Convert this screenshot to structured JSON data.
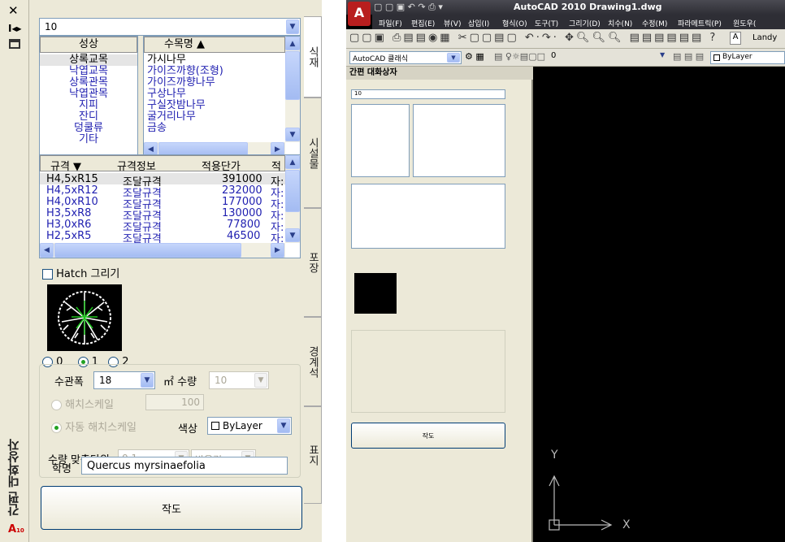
{
  "left": {
    "dropdown_top": "10",
    "list1": {
      "header": "성상",
      "items": [
        "상록교목",
        "낙엽교목",
        "상록관목",
        "낙엽관목",
        "지피",
        "잔디",
        "덩쿨류",
        "기타"
      ]
    },
    "list2": {
      "header": "수목명 ▲",
      "items": [
        "가시나무",
        "가이즈까향(조형)",
        "가이즈까향나무",
        "구상나무",
        "구실잣밤나무",
        "굴거리나무",
        "금송"
      ]
    },
    "table": {
      "headers": [
        "규격 ▼",
        "규격정보",
        "적용단가",
        "적"
      ],
      "rows": [
        [
          "H4,5xR15",
          "조달규격",
          "391000",
          "자:"
        ],
        [
          "H4,5xR12",
          "조달규격",
          "232000",
          "자:"
        ],
        [
          "H4,0xR10",
          "조달규격",
          "177000",
          "자:"
        ],
        [
          "H3,5xR8",
          "조달규격",
          "130000",
          "자:"
        ],
        [
          "H3,0xR6",
          "조달규격",
          "77800",
          "자:"
        ],
        [
          "H2,5xR5",
          "조달규격",
          "46500",
          "자:"
        ]
      ]
    },
    "hatch_label": "Hatch 그리기",
    "radios": [
      "0",
      "1",
      "2"
    ],
    "spacing_label": "수관폭",
    "spacing_value": "18",
    "qty_label": "㎡ 수량",
    "qty_value": "10",
    "hatch_scale_label": "해치스케일",
    "hatch_scale_value": "100",
    "auto_scale_label": "자동 해치스케일",
    "color_label": "색상",
    "color_value": "ByLayer",
    "unit_label": "수량 맞춤단위",
    "unit_value": "0,1",
    "round_value": "반올림",
    "sci_label": "학명",
    "sci_value": "Quercus myrsinaefolia",
    "draw_button": "작도",
    "side_tabs": [
      "식재",
      "시설물",
      "포장",
      "경계석",
      "표지"
    ],
    "palette_title": "간편 대화상자",
    "app_letter": "A",
    "app_sub": "10"
  },
  "right": {
    "app_title": "AutoCAD 2010 Drawing1.dwg",
    "menu": [
      "파일(F)",
      "편집(E)",
      "뷰(V)",
      "삽입(I)",
      "형식(O)",
      "도구(T)",
      "그리기(D)",
      "치수(N)",
      "수정(M)",
      "파라메트릭(P)",
      "윈도우("
    ],
    "workspace": "AutoCAD 클래식",
    "layer": "0",
    "bylayer": "ByLayer",
    "style": "Landy",
    "palette_title": "간편 대화상자",
    "axis_x": "X",
    "axis_y": "Y"
  }
}
